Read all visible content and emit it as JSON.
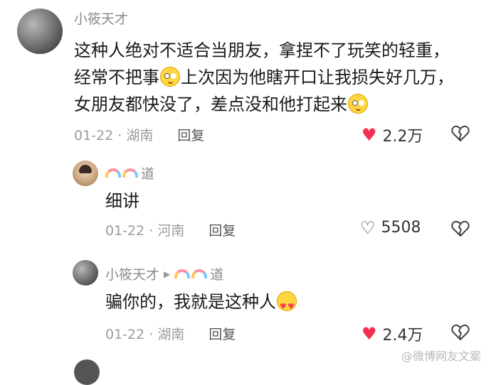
{
  "comments": [
    {
      "username": "小筱天才",
      "lines": [
        {
          "text": "这种人绝对不适合当朋友，拿捏不了玩笑的轻重，"
        },
        {
          "before": "经常不把事",
          "after": "上次因为他瞎开口让我损失好几万，"
        },
        {
          "text": "女朋友都快没了，差点没和他打起来"
        }
      ],
      "emojis": [
        "blush",
        "blush"
      ],
      "date": "01-22",
      "location": "湖南",
      "reply_label": "回复",
      "likes": "2.2万",
      "liked": true
    },
    {
      "username": "道",
      "text": "细讲",
      "date": "01-22",
      "location": "河南",
      "reply_label": "回复",
      "likes": "5508",
      "liked": false
    },
    {
      "username": "小筱天才",
      "reply_to": "道",
      "text": "骗你的，我就是这种人",
      "emoji": "heart-eyes",
      "date": "01-22",
      "location": "湖南",
      "reply_label": "回复",
      "likes": "2.4万",
      "liked": true
    }
  ],
  "separator": "·",
  "watermark": "@微博网友文案",
  "colors": {
    "like_red": "#f23051",
    "meta_gray": "#9b9b9b"
  }
}
